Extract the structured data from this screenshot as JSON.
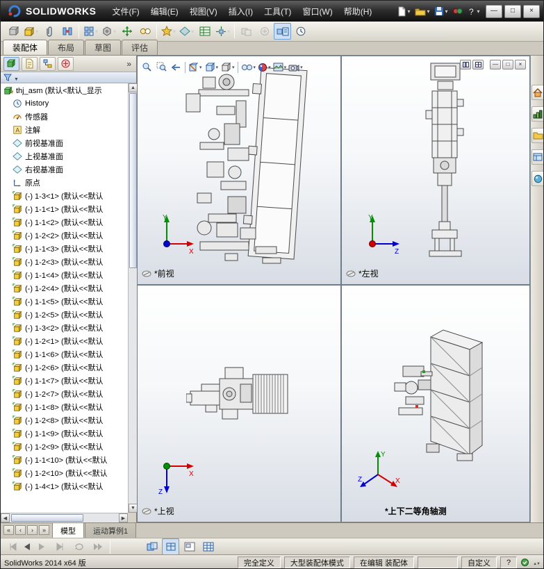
{
  "titlebar": {
    "brand": "SOLIDWORKS",
    "menus": [
      "文件(F)",
      "编辑(E)",
      "视图(V)",
      "插入(I)",
      "工具(T)",
      "窗口(W)",
      "帮助(H)"
    ],
    "quick_icons": [
      "new-document-icon",
      "open-icon",
      "save-icon",
      "options-icon",
      "help-icon"
    ]
  },
  "window_controls": {
    "minimize": "—",
    "maximize": "□",
    "close": "×"
  },
  "toolbar": {
    "icons": [
      "smart-component-icon",
      "insert-component-icon",
      "paperclip-icon",
      "mate-icon",
      "component-pattern-icon",
      "smart-fasteners-icon",
      "move-component-icon",
      "show-hidden-components-icon",
      "assembly-features-icon",
      "reference-geometry-icon",
      "bom-icon",
      "exploded-view-icon",
      "interference-detection-icon",
      "large-assembly-mode-icon",
      "motion-study-icon"
    ]
  },
  "command_tabs": [
    "装配体",
    "布局",
    "草图",
    "评估"
  ],
  "feature_panel": {
    "tab_icons": [
      "featuremanager-tree-icon",
      "propertymanager-icon",
      "configurationmanager-icon",
      "dimxpert-icon"
    ],
    "overflow": "»",
    "root_label": "thj_asm (默认<默认_显示",
    "special_items": [
      "History",
      "传感器",
      "注解",
      "前视基准面",
      "上视基准面",
      "右视基准面",
      "原点"
    ],
    "components": [
      "(-) 1-3<1> (默认<<默认",
      "(-) 1-1<1> (默认<<默认",
      "(-) 1-1<2> (默认<<默认",
      "(-) 1-2<2> (默认<<默认",
      "(-) 1-1<3> (默认<<默认",
      "(-) 1-2<3> (默认<<默认",
      "(-) 1-1<4> (默认<<默认",
      "(-) 1-2<4> (默认<<默认",
      "(-) 1-1<5> (默认<<默认",
      "(-) 1-2<5> (默认<<默认",
      "(-) 1-3<2> (默认<<默认",
      "(-) 1-2<1> (默认<<默认",
      "(-) 1-1<6> (默认<<默认",
      "(-) 1-2<6> (默认<<默认",
      "(-) 1-1<7> (默认<<默认",
      "(-) 1-2<7> (默认<<默认",
      "(-) 1-1<8> (默认<<默认",
      "(-) 1-2<8> (默认<<默认",
      "(-) 1-1<9> (默认<<默认",
      "(-) 1-2<9> (默认<<默认",
      "(-) 1-1<10> (默认<<默认",
      "(-) 1-2<10> (默认<<默认",
      "(-) 1-4<1> (默认<<默认"
    ]
  },
  "headsup_toolbar": {
    "icons": [
      "zoom-fit-icon",
      "zoom-area-icon",
      "previous-view-icon",
      "section-view-icon",
      "view-orientation-icon",
      "display-style-icon",
      "hide-show-items-icon",
      "edit-appearance-icon",
      "apply-scene-icon",
      "view-settings-icon"
    ]
  },
  "viewports": {
    "front": "*前视",
    "left": "*左视",
    "top": "*上视",
    "isometric": "*上下二等角轴测",
    "axes": {
      "x": "X",
      "y": "Y",
      "z": "Z"
    }
  },
  "taskpane": {
    "icons": [
      "resources-home-icon",
      "design-library-icon",
      "file-explorer-icon",
      "view-palette-icon",
      "appearances-scenes-icon"
    ]
  },
  "bottom_nav": [
    "«",
    "‹",
    "›",
    "»"
  ],
  "bottom_tabs": [
    "模型",
    "运动算例1"
  ],
  "status_bar": {
    "version": "SolidWorks 2014 x64 版",
    "defined_state": "完全定义",
    "assembly_mode": "大型装配体模式",
    "editing_state": "在编辑 装配体",
    "units": "自定义",
    "help": "?"
  },
  "colors": {
    "axis_x": "#d40000",
    "axis_y": "#009000",
    "axis_z": "#0000d0",
    "accent": "#2f6fbf"
  }
}
